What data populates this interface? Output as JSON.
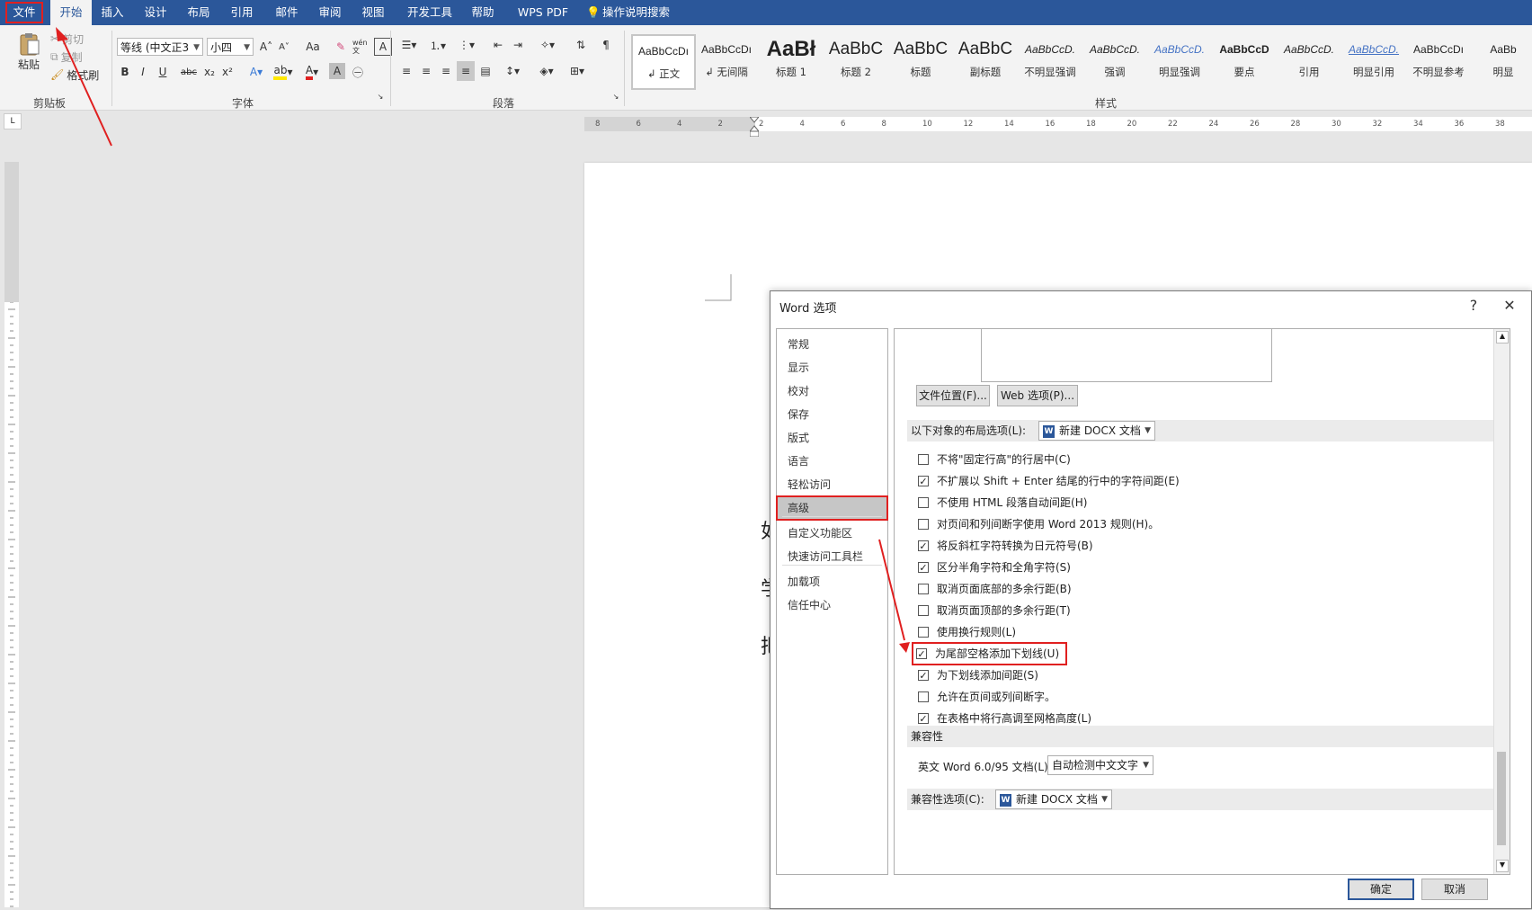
{
  "tabs": [
    "文件",
    "开始",
    "插入",
    "设计",
    "布局",
    "引用",
    "邮件",
    "审阅",
    "视图",
    "开发工具",
    "帮助",
    "WPS PDF",
    "操作说明搜索"
  ],
  "ribbon": {
    "clipboard": {
      "paste": "粘贴",
      "cut": "剪切",
      "copy": "复制",
      "format_painter": "格式刷",
      "label": "剪贴板"
    },
    "font": {
      "name": "等线 (中文正3",
      "size": "小四",
      "bold": "B",
      "italic": "I",
      "underline": "U",
      "strike": "abc",
      "sub": "x₂",
      "sup": "x²",
      "label": "字体",
      "grow": "A˄",
      "shrink": "A˅",
      "case": "Aa",
      "wen": "wén 文",
      "boxA": "A"
    },
    "paragraph": {
      "label": "段落"
    },
    "styles": {
      "label": "样式",
      "items": [
        {
          "sample": "AaBbCcDı",
          "name": "↲ 正文"
        },
        {
          "sample": "AaBbCcDı",
          "name": "↲ 无间隔"
        },
        {
          "sample": "AaBł",
          "name": "标题 1"
        },
        {
          "sample": "AaBbC",
          "name": "标题 2"
        },
        {
          "sample": "AaBbC",
          "name": "标题"
        },
        {
          "sample": "AaBbC",
          "name": "副标题"
        },
        {
          "sample": "AaBbCcD.",
          "name": "不明显强调"
        },
        {
          "sample": "AaBbCcD.",
          "name": "强调"
        },
        {
          "sample": "AaBbCcD.",
          "name": "明显强调"
        },
        {
          "sample": "AaBbCcD",
          "name": "要点"
        },
        {
          "sample": "AaBbCcD.",
          "name": "引用"
        },
        {
          "sample": "AaBbCcD.",
          "name": "明显引用"
        },
        {
          "sample": "AaBbCcDı",
          "name": "不明显参考"
        },
        {
          "sample": "AaBb",
          "name": "明显"
        }
      ]
    }
  },
  "ruler": {
    "h_ticks": [
      "8",
      "6",
      "4",
      "2",
      "2",
      "4",
      "6",
      "8",
      "10",
      "12",
      "14",
      "16",
      "18",
      "20",
      "22",
      "24",
      "26",
      "28",
      "30",
      "32",
      "34",
      "36",
      "38"
    ],
    "tab_marker": "L"
  },
  "document": {
    "chars": [
      "如",
      "学",
      "把"
    ]
  },
  "dialog": {
    "title": "Word 选项",
    "help": "?",
    "close": "✕",
    "nav": [
      "常规",
      "显示",
      "校对",
      "保存",
      "版式",
      "语言",
      "轻松访问",
      "高级",
      "自定义功能区",
      "快速访问工具栏",
      "加载项",
      "信任中心"
    ],
    "selected_nav": "高级",
    "buttons": {
      "file_locations": "文件位置(F)...",
      "web_options": "Web 选项(P)..."
    },
    "layout_section": {
      "label": "以下对象的布局选项(L):",
      "doc": "新建 DOCX 文档"
    },
    "options": [
      {
        "label": "不将\"固定行高\"的行居中(C)",
        "checked": false
      },
      {
        "label": "不扩展以 Shift + Enter 结尾的行中的字符间距(E)",
        "checked": true
      },
      {
        "label": "不使用 HTML 段落自动间距(H)",
        "checked": false
      },
      {
        "label": "对页间和列间断字使用 Word 2013 规则(H)。",
        "checked": false
      },
      {
        "label": "将反斜杠字符转换为日元符号(B)",
        "checked": true
      },
      {
        "label": "区分半角字符和全角字符(S)",
        "checked": true
      },
      {
        "label": "取消页面底部的多余行距(B)",
        "checked": false
      },
      {
        "label": "取消页面顶部的多余行距(T)",
        "checked": false
      },
      {
        "label": "使用换行规则(L)",
        "checked": false
      },
      {
        "label": "为尾部空格添加下划线(U)",
        "checked": true
      },
      {
        "label": "为下划线添加间距(S)",
        "checked": true
      },
      {
        "label": "允许在页间或列间断字。",
        "checked": false
      },
      {
        "label": "在表格中将行高调至网格高度(L)",
        "checked": true
      }
    ],
    "compat_section": {
      "label": "兼容性",
      "english_label": "英文 Word 6.0/95 文档(L):",
      "english_value": "自动检测中文文字"
    },
    "compat_options": {
      "label": "兼容性选项(C):",
      "doc": "新建 DOCX 文档"
    },
    "ok": "确定",
    "cancel": "取消"
  },
  "colors": {
    "accent": "#2b579a",
    "highlight": "#e02020"
  }
}
